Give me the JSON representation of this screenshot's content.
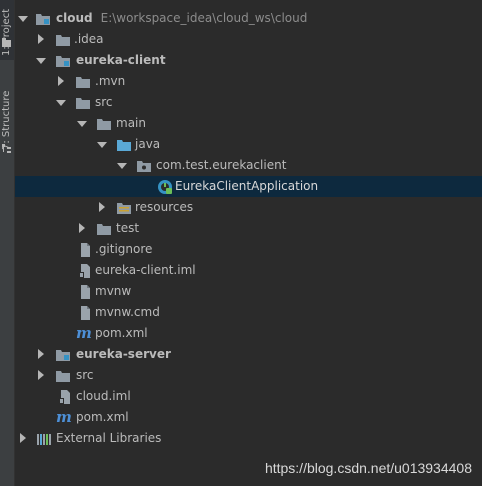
{
  "sidebar": {
    "project_tab": "1: Project",
    "structure_tab": "7: Structure"
  },
  "tree": {
    "cloud": {
      "name": "cloud",
      "path": "E:\\workspace_idea\\cloud_ws\\cloud"
    },
    "idea": "idea",
    "eureka_client": "eureka-client",
    "mvn": ".mvn",
    "src": "src",
    "main": "main",
    "java": "java",
    "package": "com.test.eurekaclient",
    "app_class": "EurekaClientApplication",
    "resources": "resources",
    "test": "test",
    "gitignore": ".gitignore",
    "client_iml": "eureka-client.iml",
    "mvnw": "mvnw",
    "mvnw_cmd": "mvnw.cmd",
    "client_pom": "pom.xml",
    "eureka_server": "eureka-server",
    "root_src": "src",
    "cloud_iml": "cloud.iml",
    "root_pom": "pom.xml",
    "external_libraries": "External Libraries"
  },
  "watermark": "https://blog.csdn.net/u013934408",
  "colors": {
    "background": "#2b2b2b",
    "selection": "#0d293e",
    "folder": "#8f9aa4",
    "source_folder": "#5aa9d6",
    "maven": "#4d8fd6"
  }
}
